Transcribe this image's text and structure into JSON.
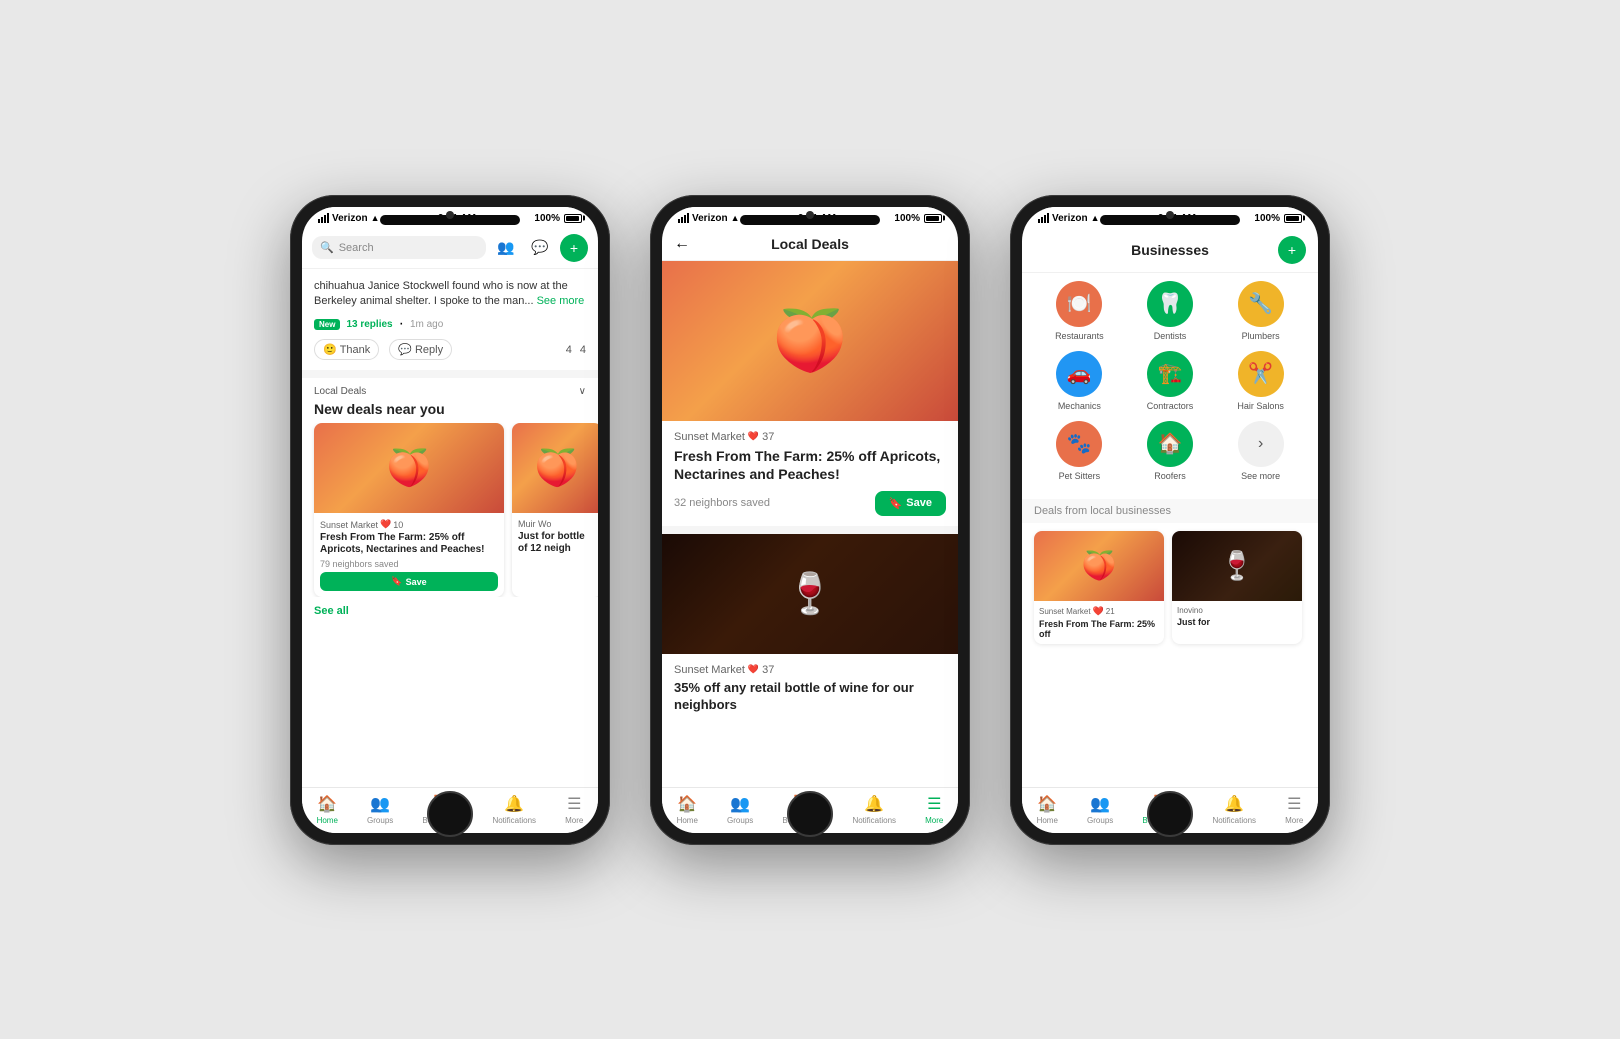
{
  "colors": {
    "green": "#00b259",
    "orange": "#e8704a",
    "yellow": "#f0b429",
    "blue": "#2196f3",
    "red": "#e0525a",
    "gray_bg": "#f5f5f5"
  },
  "phone1": {
    "status": {
      "carrier": "Verizon",
      "time": "9:41 AM",
      "battery": "100%"
    },
    "search": {
      "placeholder": "Search"
    },
    "post": {
      "text": "chihuahua Janice Stockwell found who is now at the Berkeley animal shelter. I spoke to the man...",
      "see_more": "See more",
      "badge": "New",
      "replies": "13 replies",
      "time_ago": "1m ago",
      "actions": {
        "thank": "Thank",
        "reply": "Reply",
        "emoji_count": "4",
        "comment_count": "4"
      }
    },
    "local_deals": {
      "section_label": "Local Deals",
      "title": "New deals near you",
      "card1": {
        "store": "Sunset Market",
        "likes": "10",
        "title": "Fresh From The Farm: 25% off Apricots, Nectarines and Peaches!",
        "saved": "79 neighbors saved",
        "save_btn": "Save"
      },
      "card2": {
        "store": "Muir Wo",
        "title": "Just for bottle of 12 neigh"
      },
      "see_all": "See all"
    },
    "nav": {
      "items": [
        "Home",
        "Groups",
        "Businesses",
        "Notifications",
        "More"
      ],
      "active": "Home"
    }
  },
  "phone2": {
    "status": {
      "carrier": "Verizon",
      "time": "9:41 AM",
      "battery": "100%"
    },
    "header": {
      "back": "←",
      "title": "Local Deals"
    },
    "deal1": {
      "store": "Sunset Market",
      "likes": "37",
      "title": "Fresh From The Farm: 25% off Apricots, Nectarines and Peaches!",
      "saved": "32 neighbors saved",
      "save_btn": "Save"
    },
    "deal2": {
      "store": "Sunset Market",
      "likes": "37",
      "title": "35% off any retail bottle of wine for our neighbors"
    },
    "nav": {
      "items": [
        "Home",
        "Groups",
        "Businesses",
        "Notifications",
        "More"
      ],
      "active": "More"
    }
  },
  "phone3": {
    "status": {
      "carrier": "Verizon",
      "time": "9:41 AM",
      "battery": "100%"
    },
    "header": {
      "title": "Businesses"
    },
    "categories": [
      [
        {
          "label": "Restaurants",
          "icon": "🍽️",
          "color_class": "biz-orange"
        },
        {
          "label": "Dentists",
          "icon": "🦷",
          "color_class": "biz-green"
        },
        {
          "label": "Plumbers",
          "icon": "🔧",
          "color_class": "biz-yellow"
        }
      ],
      [
        {
          "label": "Mechanics",
          "icon": "🚗",
          "color_class": "biz-blue"
        },
        {
          "label": "Contractors",
          "icon": "🏗️",
          "color_class": "biz-green2"
        },
        {
          "label": "Hair Salons",
          "icon": "✂️",
          "color_class": "biz-hairsalon"
        }
      ],
      [
        {
          "label": "Pet Sitters",
          "icon": "🐾",
          "color_class": "biz-petsitter"
        },
        {
          "label": "Roofers",
          "icon": "🏠",
          "color_class": "biz-roofer"
        },
        {
          "label": "See more",
          "icon": "›",
          "color_class": "biz-seemore",
          "is_more": true
        }
      ]
    ],
    "deals_section_label": "Deals from local businesses",
    "local_cards": [
      {
        "store": "Sunset Market",
        "likes": "21",
        "title": "Fresh From The Farm: 25% off",
        "type": "fruit"
      },
      {
        "store": "Inovino",
        "title": "Just for",
        "type": "wine"
      }
    ],
    "nav": {
      "items": [
        "Home",
        "Groups",
        "Businesses",
        "Notifications",
        "More"
      ],
      "active": "Businesses"
    }
  }
}
